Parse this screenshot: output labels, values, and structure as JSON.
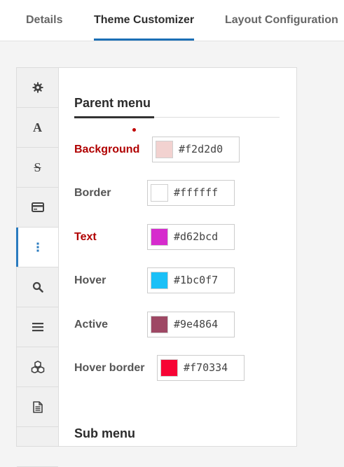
{
  "tabs": [
    {
      "label": "Details"
    },
    {
      "label": "Theme Customizer"
    },
    {
      "label": "Layout Configuration"
    }
  ],
  "sidebar": {
    "items": [
      {
        "icon": "gear-icon"
      },
      {
        "icon": "font-icon",
        "glyph": "A"
      },
      {
        "icon": "strikethrough-icon",
        "glyph": "S"
      },
      {
        "icon": "card-icon"
      },
      {
        "icon": "vertical-dots-icon",
        "active": true
      },
      {
        "icon": "search-icon"
      },
      {
        "icon": "menu-icon"
      },
      {
        "icon": "cubes-icon"
      },
      {
        "icon": "document-icon"
      },
      {
        "icon": "more-icon"
      }
    ]
  },
  "parent_menu": {
    "title": "Parent menu",
    "rows": [
      {
        "label": "Background",
        "hex": "#f2d2d0",
        "swatch": "#f2d2d0",
        "highlight": true
      },
      {
        "label": "Border",
        "hex": "#ffffff",
        "swatch": "#ffffff",
        "highlight": false
      },
      {
        "label": "Text",
        "hex": "#d62bcd",
        "swatch": "#d62bcd",
        "highlight": true
      },
      {
        "label": "Hover",
        "hex": "#1bc0f7",
        "swatch": "#1bc0f7",
        "highlight": false
      },
      {
        "label": "Active",
        "hex": "#9e4864",
        "swatch": "#9e4864",
        "highlight": false
      },
      {
        "label": "Hover border",
        "hex": "#f70334",
        "swatch": "#f70334",
        "highlight": false
      }
    ]
  },
  "sub_menu": {
    "title": "Sub menu"
  },
  "colors": {
    "accent": "#1b6fb5",
    "highlight_label": "#b00000"
  }
}
